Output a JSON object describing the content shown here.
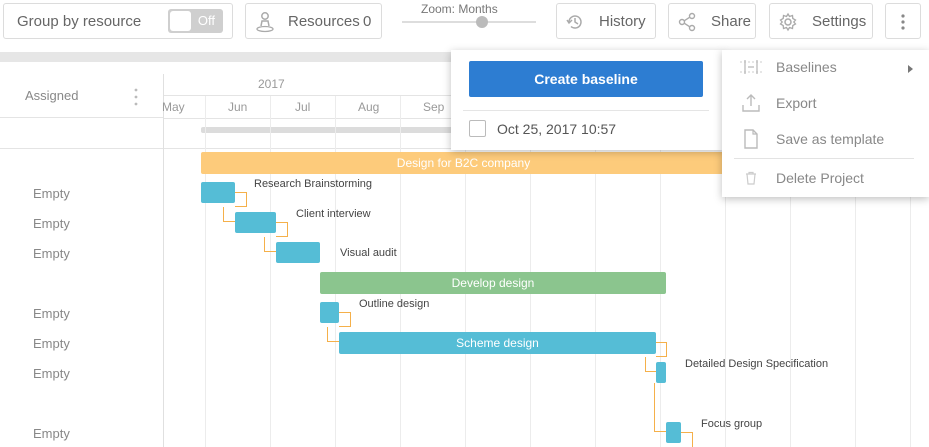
{
  "toolbar": {
    "group_by_label": "Group by resource",
    "group_by_toggle": "Off",
    "resources_label": "Resources",
    "resources_count": "0",
    "zoom_label": "Zoom: Months",
    "history_label": "History",
    "share_label": "Share",
    "settings_label": "Settings",
    "icons": {
      "resources": "person-pin-icon",
      "history": "history-clock-icon",
      "share": "share-nodes-icon",
      "settings": "gear-icon",
      "more": "more-vertical-icon"
    }
  },
  "grid": {
    "column_header": "Assigned",
    "rows": [
      "Empty",
      "Empty",
      "Empty",
      "Empty",
      "Empty",
      "Empty",
      "Empty"
    ]
  },
  "timeline": {
    "year": "2017",
    "months": [
      "May",
      "Jun",
      "Jul",
      "Aug",
      "Sep"
    ]
  },
  "tasks": {
    "design_b2c": "Design for B2C company",
    "research": "Research Brainstorming",
    "interview": "Client interview",
    "visual_audit": "Visual audit",
    "develop": "Develop design",
    "outline": "Outline design",
    "scheme": "Scheme design",
    "detailed_spec": "Detailed Design Specification",
    "focus_group": "Focus group"
  },
  "baseline_popup": {
    "create_label": "Create baseline",
    "baseline_date": "Oct 25, 2017 10:57"
  },
  "more_menu": {
    "baselines": "Baselines",
    "export": "Export",
    "save_template": "Save as template",
    "delete_project": "Delete Project"
  },
  "colors": {
    "summary_orange": "#fdcb7b",
    "summary_green": "#8bc58e",
    "task_blue": "#55bdd6",
    "connector": "#f5b04a",
    "primary_button": "#2d7dd2"
  }
}
